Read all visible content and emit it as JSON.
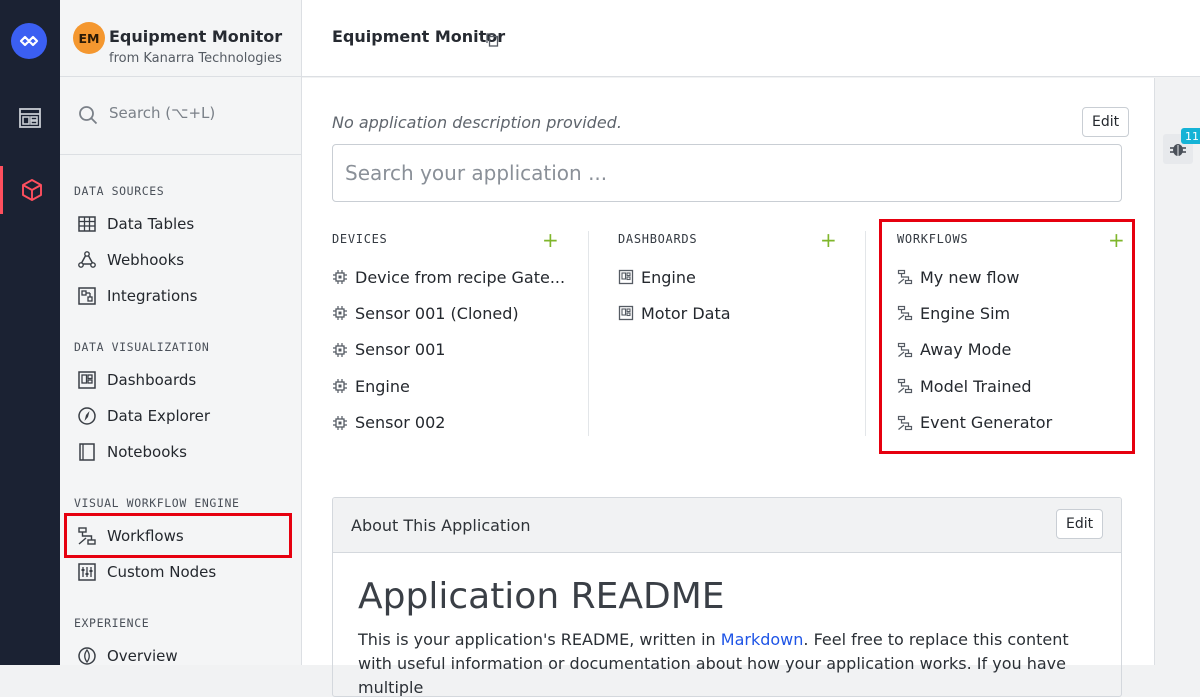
{
  "app": {
    "initials": "EM",
    "name": "Equipment Monitor",
    "org": "from Kanarra Technologies"
  },
  "sidebar": {
    "search_placeholder": "Search (⌥+L)",
    "sections": [
      {
        "title": "DATA SOURCES",
        "items": [
          {
            "label": "Data Tables",
            "icon": "table-icon"
          },
          {
            "label": "Webhooks",
            "icon": "webhook-icon"
          },
          {
            "label": "Integrations",
            "icon": "integrations-icon"
          }
        ]
      },
      {
        "title": "DATA VISUALIZATION",
        "items": [
          {
            "label": "Dashboards",
            "icon": "dashboard-icon"
          },
          {
            "label": "Data Explorer",
            "icon": "compass-icon"
          },
          {
            "label": "Notebooks",
            "icon": "notebook-icon"
          }
        ]
      },
      {
        "title": "VISUAL WORKFLOW ENGINE",
        "items": [
          {
            "label": "Workflows",
            "icon": "workflow-icon"
          },
          {
            "label": "Custom Nodes",
            "icon": "sliders-icon"
          }
        ]
      },
      {
        "title": "EXPERIENCE",
        "items": [
          {
            "label": "Overview",
            "icon": "overview-icon"
          }
        ]
      }
    ]
  },
  "header": {
    "title": "Equipment Monitor"
  },
  "main": {
    "description": "No application description provided.",
    "edit_label": "Edit",
    "search_placeholder": "Search your application ...",
    "columns": {
      "devices": {
        "title": "DEVICES",
        "items": [
          "Device from recipe Gate...",
          "Sensor 001 (Cloned)",
          "Sensor 001",
          "Engine",
          "Sensor 002"
        ]
      },
      "dashboards": {
        "title": "DASHBOARDS",
        "items": [
          "Engine",
          "Motor Data"
        ]
      },
      "workflows": {
        "title": "WORKFLOWS",
        "items": [
          "My new flow",
          "Engine Sim",
          "Away Mode",
          "Model Trained",
          "Event Generator"
        ]
      }
    },
    "add_symbol": "+",
    "about": {
      "title": "About This Application",
      "edit_label": "Edit",
      "readme_heading": "Application README",
      "readme_text_1": "This is your application's README, written in ",
      "readme_link": "Markdown",
      "readme_text_2": ". Feel free to replace this content with useful information or documentation about how your application works. If you have multiple"
    }
  },
  "right_strip": {
    "badge_count": "11"
  },
  "colors": {
    "rail": "#1b2233",
    "accent_red": "#e6000f",
    "plus_green": "#7fb62b",
    "link_blue": "#1f55e6",
    "badge_cyan": "#15b3d6"
  }
}
